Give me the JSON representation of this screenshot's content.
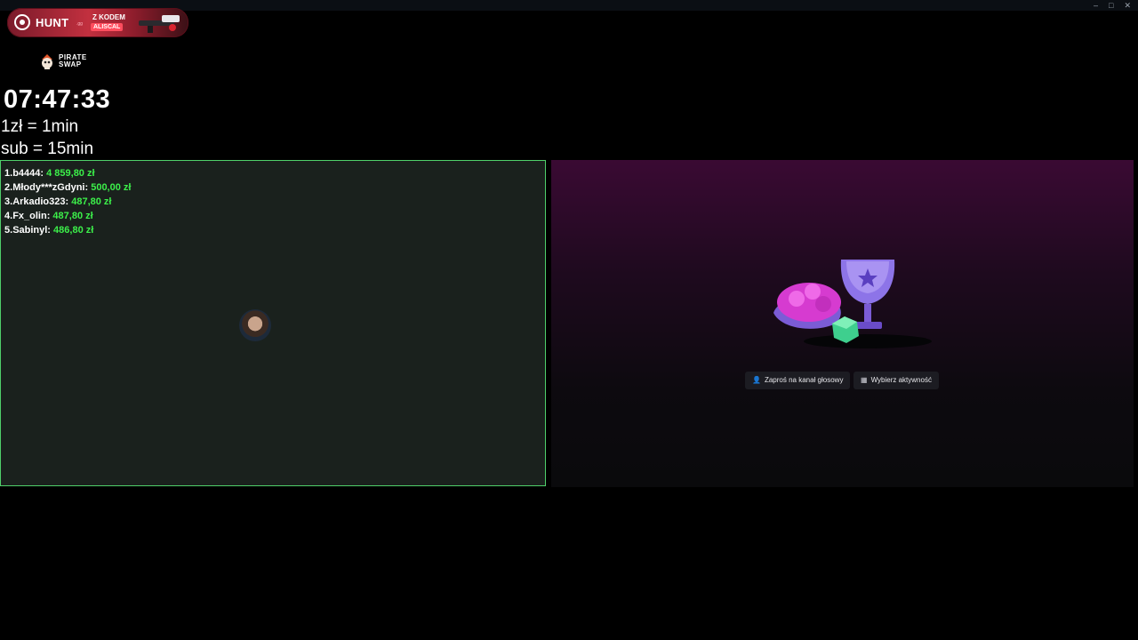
{
  "window_controls": {
    "minimize": "–",
    "maximize": "□",
    "close": "✕"
  },
  "sponsor_banner": {
    "brand": "HUNT",
    "brand_suffix": ".gg",
    "promo_label": "Z KODEM",
    "promo_code": "ALISCAL"
  },
  "sponsor_logo": {
    "line1": "PIRATE",
    "line2": "SWAP"
  },
  "timer": {
    "value": "07:47:33"
  },
  "rates": {
    "donation": "1zł = 1min",
    "sub": "sub = 15min"
  },
  "leaderboard": [
    {
      "rank": "1.",
      "name": "b4444:",
      "amount": "4 859,80 zł"
    },
    {
      "rank": "2.",
      "name": "Młody***zGdyni:",
      "amount": "500,00 zł"
    },
    {
      "rank": "3.",
      "name": "Arkadio323:",
      "amount": "487,80 zł"
    },
    {
      "rank": "4.",
      "name": "Fx_olin:",
      "amount": "487,80 zł"
    },
    {
      "rank": "5.",
      "name": "Sabinyl:",
      "amount": "486,80 zł"
    }
  ],
  "activity": {
    "invite_button": "Zaproś na kanał głosowy",
    "activity_button": "Wybierz aktywność",
    "invite_icon": "person-add-icon",
    "activity_icon": "grid-icon"
  },
  "colors": {
    "panel_border": "#4fd06a",
    "amount_green": "#3cf04a",
    "banner_red": "#c2303f",
    "activity_bg_top": "#3a0a33"
  }
}
